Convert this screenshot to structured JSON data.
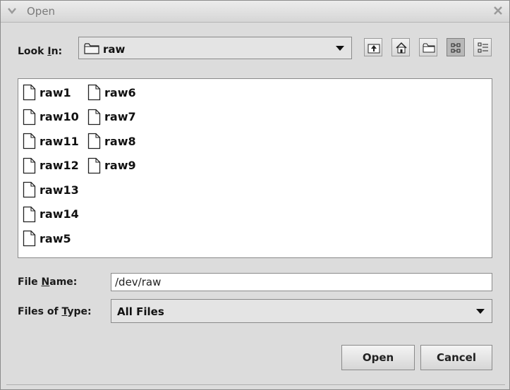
{
  "window": {
    "title": "Open"
  },
  "look_in": {
    "label_pre": "Look ",
    "label_mnemonic": "I",
    "label_post": "n:",
    "value": "raw",
    "icon": "folder-icon"
  },
  "toolbar": {
    "buttons": [
      {
        "name": "up-one-level-icon"
      },
      {
        "name": "home-icon"
      },
      {
        "name": "new-folder-icon"
      },
      {
        "name": "list-view-icon",
        "selected": true
      },
      {
        "name": "details-view-icon"
      }
    ]
  },
  "files": [
    "raw1",
    "raw10",
    "raw11",
    "raw12",
    "raw13",
    "raw14",
    "raw5",
    "raw6",
    "raw7",
    "raw8",
    "raw9"
  ],
  "file_name": {
    "label_pre": "File ",
    "label_mnemonic": "N",
    "label_post": "ame:",
    "value": "/dev/raw"
  },
  "files_of_type": {
    "label_pre": "Files of ",
    "label_mnemonic": "T",
    "label_post": "ype:",
    "value": "All Files"
  },
  "buttons": {
    "open": "Open",
    "cancel": "Cancel"
  }
}
